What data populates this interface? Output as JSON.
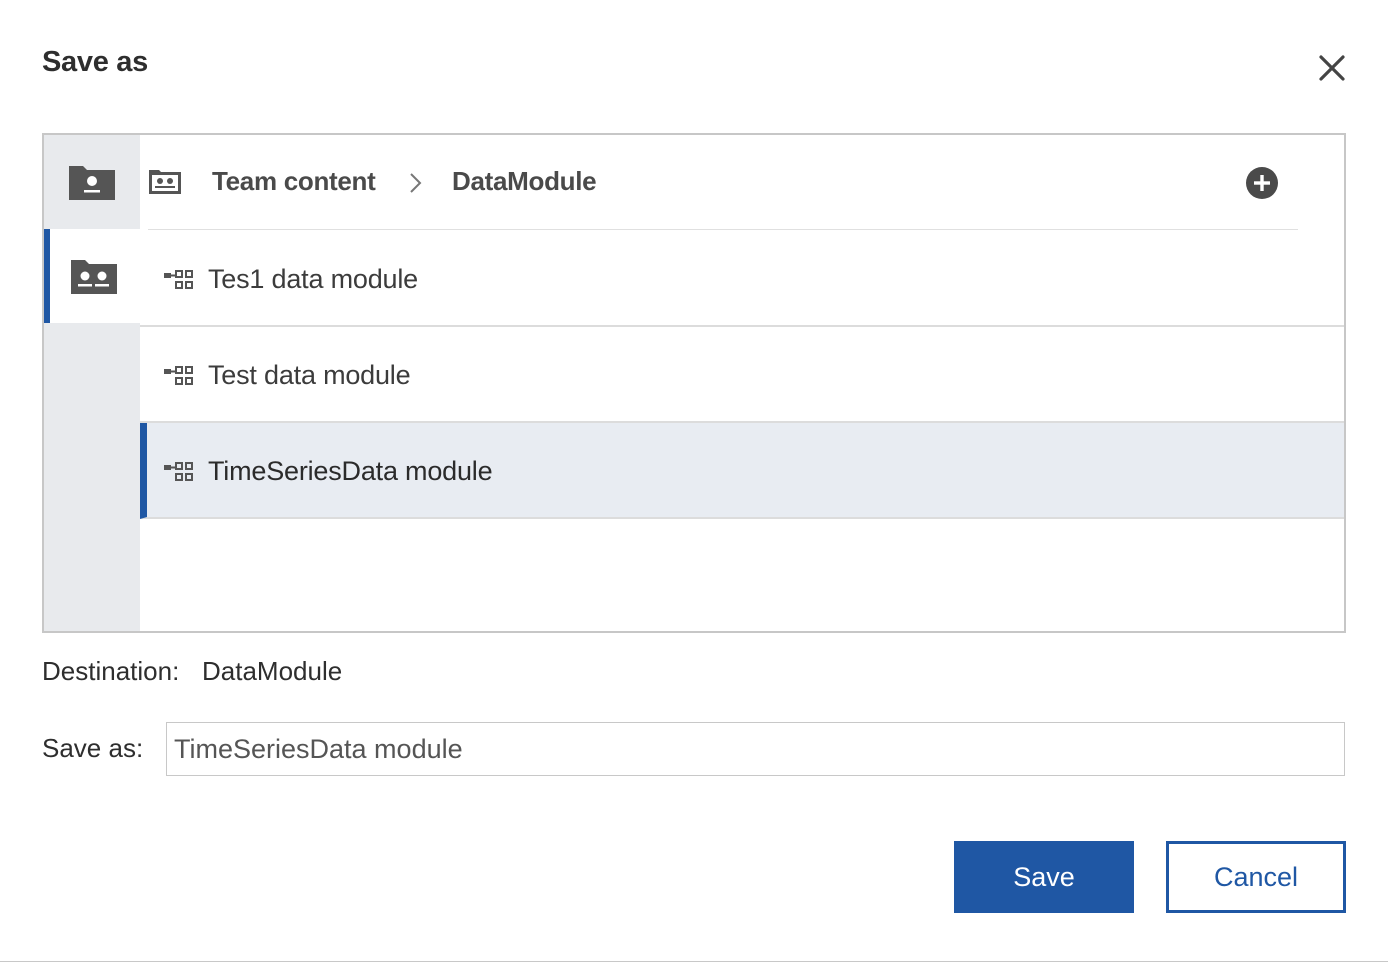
{
  "dialog": {
    "title": "Save as"
  },
  "icons": {
    "close": "close-icon",
    "my_content": "my-content-folder-icon",
    "team_content": "team-content-folder-icon",
    "breadcrumb_separator": "chevron-right-icon",
    "add": "add-folder-icon",
    "data_module": "data-module-icon"
  },
  "breadcrumb": {
    "items": [
      "Team content",
      "DataModule"
    ]
  },
  "list": {
    "items": [
      {
        "label": "Tes1 data module",
        "selected": false
      },
      {
        "label": "Test data module",
        "selected": false
      },
      {
        "label": "TimeSeriesData module",
        "selected": true
      }
    ]
  },
  "destination": {
    "label": "Destination:",
    "value": "DataModule"
  },
  "save_as": {
    "label": "Save as:",
    "value": "TimeSeriesData module"
  },
  "buttons": {
    "save": "Save",
    "cancel": "Cancel"
  },
  "colors": {
    "accent": "#1f57a4",
    "selected_row_bg": "#e8ecf2",
    "rail_bg": "#e8eaed"
  }
}
